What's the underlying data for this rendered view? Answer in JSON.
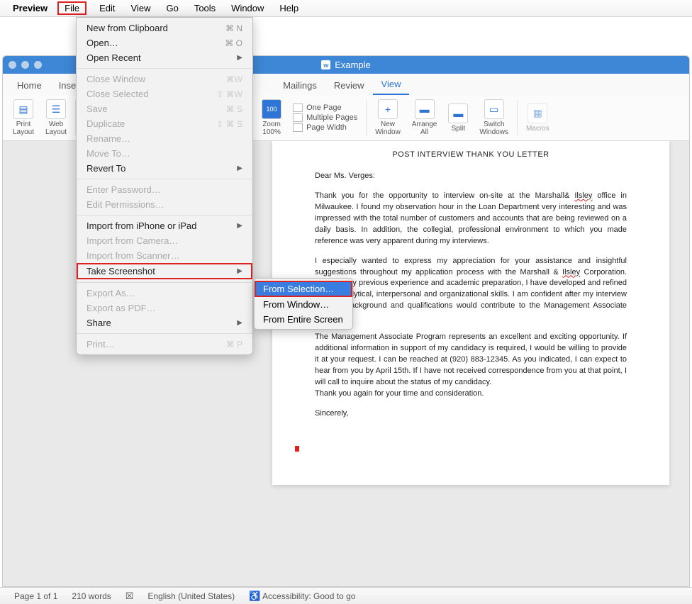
{
  "menubar": {
    "appname": "Preview",
    "items": [
      "File",
      "Edit",
      "View",
      "Go",
      "Tools",
      "Window",
      "Help"
    ]
  },
  "file_menu": {
    "new_clipboard": "New from Clipboard",
    "new_clipboard_sc": "⌘ N",
    "open": "Open…",
    "open_sc": "⌘ O",
    "open_recent": "Open Recent",
    "close_window": "Close Window",
    "close_window_sc": "⌘W",
    "close_selected": "Close Selected",
    "close_selected_sc": "⇧ ⌘W",
    "save": "Save",
    "save_sc": "⌘ S",
    "duplicate": "Duplicate",
    "duplicate_sc": "⇧ ⌘ S",
    "rename": "Rename…",
    "move_to": "Move To…",
    "revert_to": "Revert To",
    "enter_password": "Enter Password…",
    "edit_permissions": "Edit Permissions…",
    "import_iphone": "Import from iPhone or iPad",
    "import_camera": "Import from Camera…",
    "import_scanner": "Import from Scanner…",
    "take_screenshot": "Take Screenshot",
    "export_as": "Export As…",
    "export_pdf": "Export as PDF…",
    "share": "Share",
    "print": "Print…",
    "print_sc": "⌘ P"
  },
  "screenshot_submenu": {
    "from_selection": "From Selection…",
    "from_window": "From Window…",
    "from_screen": "From Entire Screen"
  },
  "window": {
    "title": "Example",
    "tabs": [
      "Home",
      "Insert",
      "",
      "",
      "",
      "Mailings",
      "Review",
      "View"
    ],
    "active_tab": "View"
  },
  "ribbon": {
    "print_layout": "Print\nLayout",
    "web_layout": "Web\nLayout",
    "zoom": "Zoom\n100%",
    "one_page": "One Page",
    "multiple_pages": "Multiple Pages",
    "page_width": "Page Width",
    "new_window": "New\nWindow",
    "arrange_all": "Arrange\nAll",
    "split": "Split",
    "switch_windows": "Switch\nWindows",
    "macros": "Macros"
  },
  "document": {
    "title": "POST INTERVIEW THANK YOU LETTER",
    "greeting": "Dear Ms. Verges:",
    "p1a": "Thank you for the opportunity to interview on-site at the Marshall& ",
    "p1_word1": "Ilsley",
    "p1b": " office in Milwaukee. I found my observation hour in the Loan Department very interesting and was impressed with the total number of customers and accounts that are being reviewed on a daily basis. In addition, the collegial, professional environment to which you made reference was very apparent during my interviews.",
    "p2a": "I especially wanted to express my appreciation for your assistance and insightful suggestions throughout my application process with the Marshall & ",
    "p2_word1": "Ilsley",
    "p2b": " Corporation. Through my previous experience and academic preparation, I have developed and refined strong analytical, interpersonal and organizational skills. I am confident after my interview that my background and qualifications would contribute to the Management Associate Program.",
    "p3": "The Management Associate Program represents an excellent and exciting opportunity. If additional information in support of my candidacy is required, I would be willing to provide it at your request. I can be reached at (920) 883-12345. As you indicated, I can expect to hear from you by April 15th. If I have not received correspondence from you at that point, I will call to inquire about the status of my candidacy.",
    "p4": "Thank you again for your time and consideration.",
    "closing": "Sincerely,"
  },
  "statusbar": {
    "page": "Page 1 of 1",
    "words": "210 words",
    "lang": "English (United States)",
    "accessibility": "Accessibility: Good to go"
  }
}
